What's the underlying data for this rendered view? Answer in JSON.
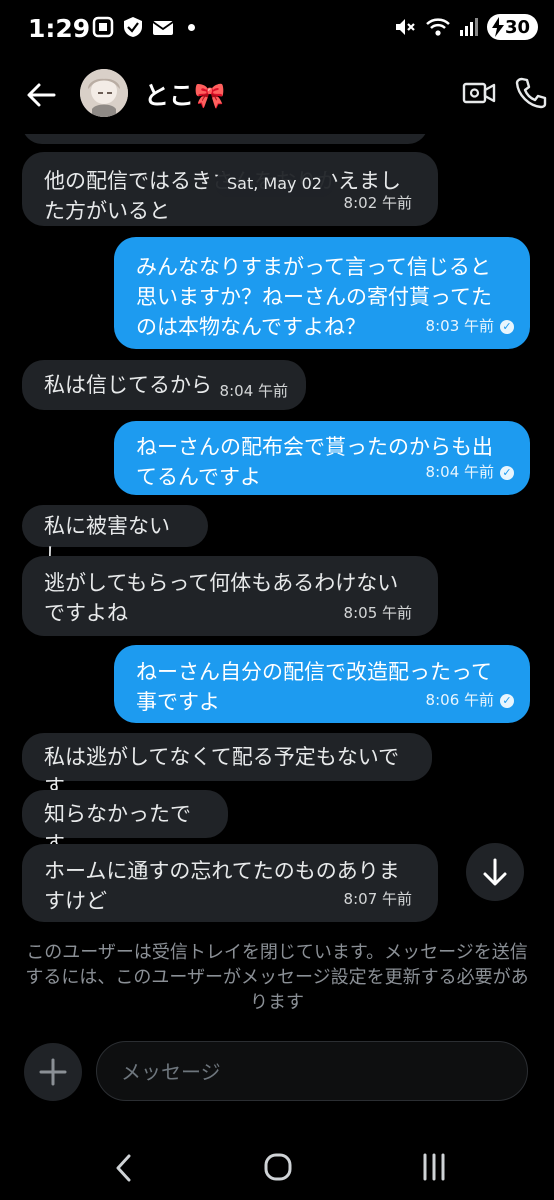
{
  "status_bar": {
    "time": "1:29",
    "battery": "30"
  },
  "header": {
    "title": "とこ🎀"
  },
  "date_separator": "Sat, May 02",
  "messages": [
    {
      "dir": "in",
      "text": "他の配信ではるきさんをおりかえました方がいると",
      "time": "8:02 午前"
    },
    {
      "dir": "out",
      "text": "みんななりすまがって言って信じると思いますか？ねーさんの寄付貰ってたのは本物なんですよね？",
      "time": "8:03 午前"
    },
    {
      "dir": "in",
      "text": "私は信じてるから",
      "time": "8:04 午前"
    },
    {
      "dir": "out",
      "text": "ねーさんの配布会で貰ったのからも出てるんですよ",
      "time": "8:04 午前"
    },
    {
      "dir": "in",
      "text": "私に被害ないし",
      "time": ""
    },
    {
      "dir": "in",
      "text": "逃がしてもらって何体もあるわけないですよね",
      "time": "8:05 午前"
    },
    {
      "dir": "out",
      "text": "ねーさん自分の配信で改造配ったって事ですよ",
      "time": "8:06 午前"
    },
    {
      "dir": "in",
      "text": "私は逃がしてなくて配る予定もないです",
      "time": ""
    },
    {
      "dir": "in",
      "text": "知らなかったです",
      "time": ""
    },
    {
      "dir": "in",
      "text": "ホームに通すの忘れてたのものありますけど",
      "time": "8:07 午前"
    }
  ],
  "notice": "このユーザーは受信トレイを閉じています。メッセージを送信するには、このユーザーがメッセージ設定を更新する必要があります",
  "composer": {
    "placeholder": "メッセージ"
  },
  "colors": {
    "outgoing": "#1d9bf0",
    "incoming": "#202327",
    "background": "#000000"
  },
  "icons": [
    "back-arrow-icon",
    "video-call-icon",
    "phone-icon",
    "scroll-down-icon",
    "plus-icon",
    "nav-back-icon",
    "nav-home-icon",
    "nav-recents-icon"
  ]
}
